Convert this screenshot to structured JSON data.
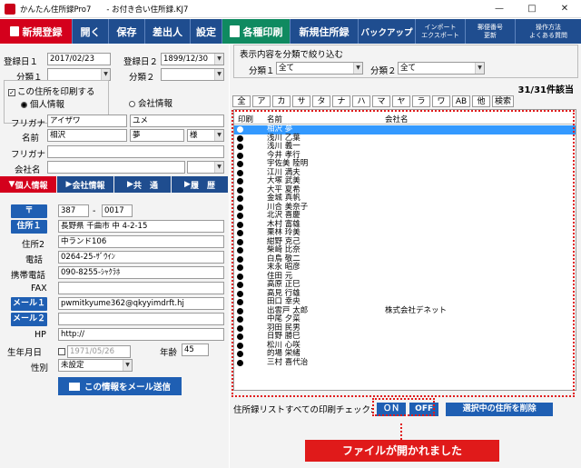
{
  "window": {
    "title": "かんたん住所録Pro7　　- お付き合い住所録.KJ7",
    "min": "—",
    "max": "□",
    "close": "✕"
  },
  "toolbar": {
    "new": "新規登録",
    "open": "開く",
    "save": "保存",
    "sender": "差出人",
    "settings": "設定",
    "print": "各種印刷",
    "new_file": "新規住所録",
    "backup": "バックアップ",
    "import1": "インポート",
    "import2": "エクスポート",
    "postal1": "郵便番号",
    "postal2": "更新",
    "help1": "操作方法",
    "help2": "よくある質問"
  },
  "form": {
    "reg1_label": "登録日１",
    "reg1": "2017/02/23",
    "reg2_label": "登録日２",
    "reg2": "1899/12/30",
    "cat1_label": "分類１",
    "cat2_label": "分類２",
    "print_chk": "この住所を印刷する",
    "personal": "個人情報",
    "company": "会社情報",
    "furigana_label": "フリガナ",
    "furi_last": "アイザワ",
    "furi_first": "ユメ",
    "name_label": "名前",
    "last": "相沢",
    "first": "夢",
    "honorific": "様",
    "furigana2_label": "フリガナ",
    "company_label": "会社名"
  },
  "tabs": [
    "個人情報",
    "会社情報",
    "共　通",
    "履　歴"
  ],
  "address": {
    "zip_label": "〒",
    "zip1": "387",
    "zip2": "0017",
    "addr1_label": "住所１",
    "addr1": "長野県 千曲市 中 4-2-15",
    "addr2_label": "住所2",
    "addr2": "中ランド106",
    "tel_label": "電話",
    "tel": "0264-25-ｻﾞｳｲﾝ",
    "mobile_label": "携帯電話",
    "mobile": "090-8255-ｼｬｸﾗﾎ",
    "fax_label": "FAX",
    "fax": "",
    "mail1_label": "メール１",
    "mail1": "pwmitkyume362@qkyyimdrft.hj",
    "mail2_label": "メール２",
    "mail2": "",
    "hp_label": "HP",
    "hp": "http://",
    "birth_label": "生年月日",
    "birth": "1971/05/26",
    "age_label": "年齢",
    "age": "45",
    "sex_label": "性別",
    "sex": "未設定",
    "send_mail": "この情報をメール送信"
  },
  "filter": {
    "title": "表示内容を分類で絞り込む",
    "cat1_label": "分類１",
    "cat1": "全て",
    "cat2_label": "分類２",
    "cat2": "全て"
  },
  "count": "31/31件該当",
  "kana": [
    "全",
    "ア",
    "カ",
    "サ",
    "タ",
    "ナ",
    "ハ",
    "マ",
    "ヤ",
    "ラ",
    "ワ",
    "AB",
    "他",
    "検索"
  ],
  "list": {
    "headers": {
      "print": "印刷",
      "name": "名前",
      "company": "会社名"
    },
    "rows": [
      {
        "name": "相沢 夢",
        "co": ""
      },
      {
        "name": "浅川 乙葉",
        "co": ""
      },
      {
        "name": "浅川 義一",
        "co": ""
      },
      {
        "name": "今井 孝行",
        "co": ""
      },
      {
        "name": "宇佐美 陸明",
        "co": ""
      },
      {
        "name": "江川 満夫",
        "co": ""
      },
      {
        "name": "大塚 武美",
        "co": ""
      },
      {
        "name": "大平 夏希",
        "co": ""
      },
      {
        "name": "金城 真帆",
        "co": ""
      },
      {
        "name": "川合 美奈子",
        "co": ""
      },
      {
        "name": "北沢 喜慶",
        "co": ""
      },
      {
        "name": "木村 富雄",
        "co": ""
      },
      {
        "name": "栗林 玲美",
        "co": ""
      },
      {
        "name": "紺野 克己",
        "co": ""
      },
      {
        "name": "柴崎 比奈",
        "co": ""
      },
      {
        "name": "白鳥 敬二",
        "co": ""
      },
      {
        "name": "末永 昭彦",
        "co": ""
      },
      {
        "name": "住田 元",
        "co": ""
      },
      {
        "name": "高原 正巳",
        "co": ""
      },
      {
        "name": "高見 行雄",
        "co": ""
      },
      {
        "name": "田口 幸央",
        "co": ""
      },
      {
        "name": "出雲戸 太郎",
        "co": "株式会社デネット"
      },
      {
        "name": "中尾 夕菜",
        "co": ""
      },
      {
        "name": "羽田 民男",
        "co": ""
      },
      {
        "name": "日野 勝巳",
        "co": ""
      },
      {
        "name": "松川 心咲",
        "co": ""
      },
      {
        "name": "的場 栄緒",
        "co": ""
      },
      {
        "name": "三村 喜代治",
        "co": ""
      }
    ]
  },
  "bottom": {
    "label": "住所録リストすべての印刷チェック:",
    "on": "ＯＮ",
    "off": "OFF",
    "delete": "選択中の住所を削除"
  },
  "notice": "ファイルが開かれました"
}
